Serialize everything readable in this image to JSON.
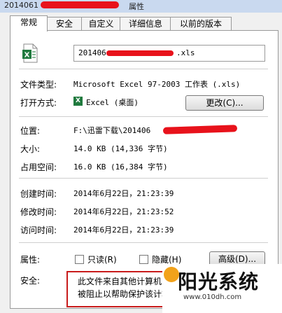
{
  "window": {
    "title_visible": "2014061",
    "title_suffix": "属性"
  },
  "tabs": [
    {
      "label": "常规"
    },
    {
      "label": "安全"
    },
    {
      "label": "自定义"
    },
    {
      "label": "详细信息"
    },
    {
      "label": "以前的版本"
    }
  ],
  "general": {
    "file_name_prefix": "201406",
    "file_name_suffix": ".xls",
    "file_type_label": "文件类型:",
    "file_type_value": "Microsoft Excel 97-2003 工作表 (.xls)",
    "open_with_label": "打开方式:",
    "open_with_value": "Excel (桌面)",
    "change_button": "更改(C)...",
    "location_label": "位置:",
    "location_value": "F:\\迅雷下载\\201406",
    "size_label": "大小:",
    "size_value": "14.0 KB (14,336 字节)",
    "size_on_disk_label": "占用空间:",
    "size_on_disk_value": "16.0 KB (16,384 字节)",
    "created_label": "创建时间:",
    "created_value": "2014年6月22日，21:23:39",
    "modified_label": "修改时间:",
    "modified_value": "2014年6月22日，21:23:52",
    "accessed_label": "访问时间:",
    "accessed_value": "2014年6月22日，21:23:39",
    "attributes_label": "属性:",
    "readonly_label": "只读(R)",
    "hidden_label": "隐藏(H)",
    "advanced_button": "高级(D)...",
    "security_label": "安全:",
    "security_line1": "此文件来自其他计算机，",
    "security_line2": "被阻止以帮助保护该计算"
  },
  "watermark": {
    "title": "阳光系统",
    "url": "www.010dh.com"
  },
  "colors": {
    "redaction": "#e8121b",
    "security_border": "#c81c1c",
    "excel_green": "#1f7a3e"
  }
}
